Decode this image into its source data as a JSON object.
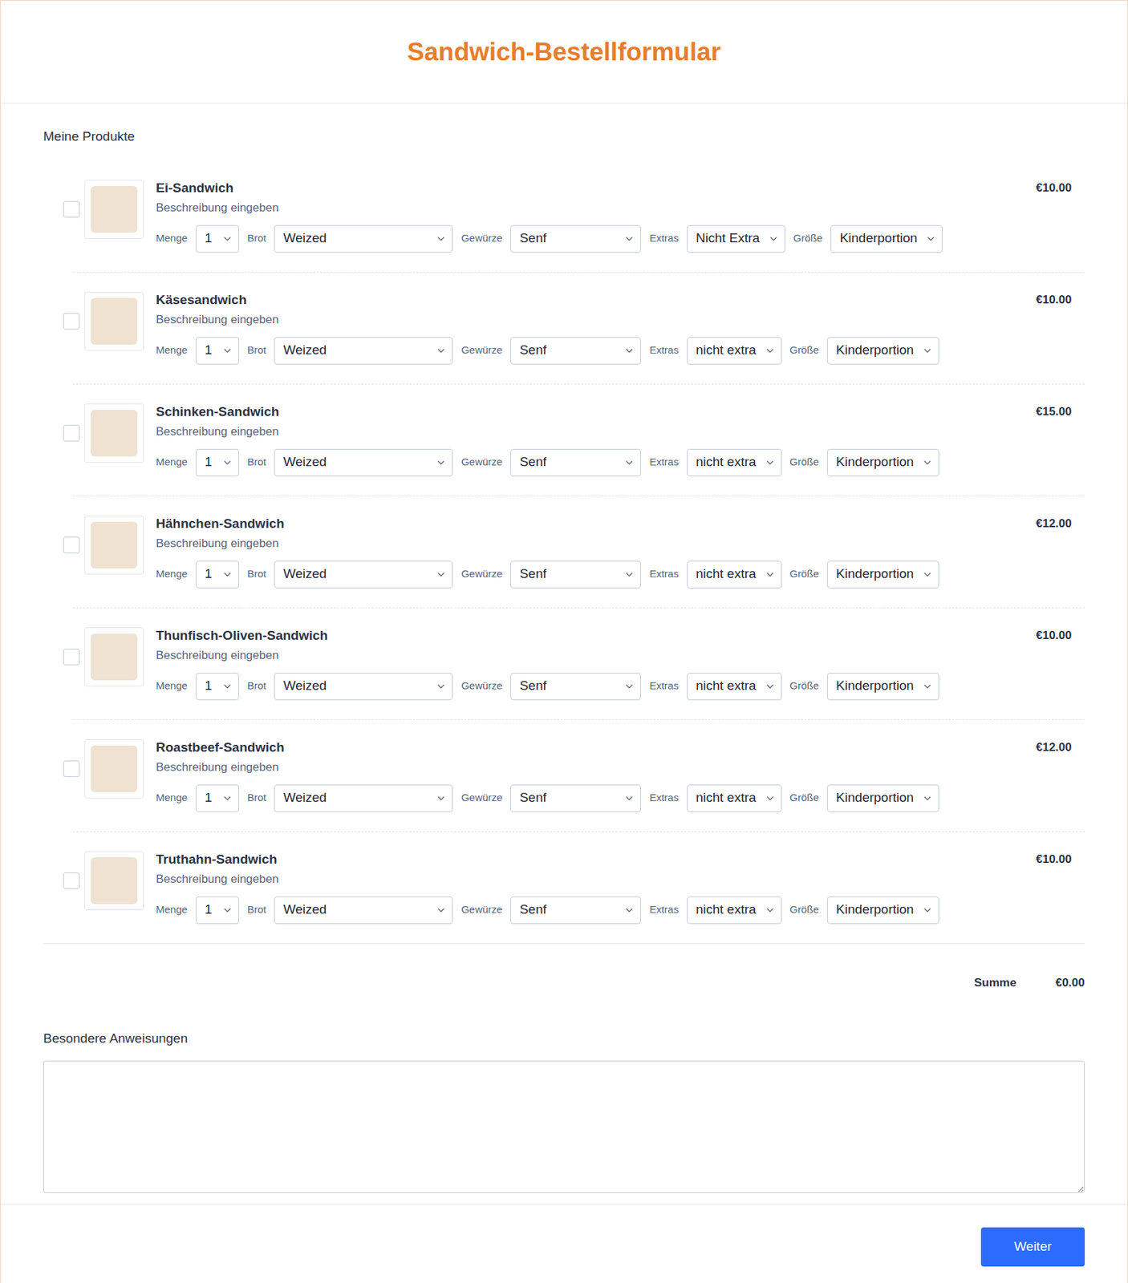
{
  "title": "Sandwich-Bestellformular",
  "products_section": {
    "title": "Meine Produkte"
  },
  "field_labels": {
    "quantity": "Menge",
    "bread": "Brot",
    "condiments": "Gewürze",
    "extras": "Extras",
    "size": "Größe"
  },
  "products": [
    {
      "name": "Ei-Sandwich",
      "description": "Beschreibung eingeben",
      "price": "€10.00",
      "checked": false,
      "quantity": "1",
      "bread": "Weized",
      "condiments": "Senf",
      "extras": "Nicht Extra",
      "size": "Kinderportion"
    },
    {
      "name": "Käsesandwich",
      "description": "Beschreibung eingeben",
      "price": "€10.00",
      "checked": false,
      "quantity": "1",
      "bread": "Weized",
      "condiments": "Senf",
      "extras": "nicht extra",
      "size": "Kinderportion"
    },
    {
      "name": "Schinken-Sandwich",
      "description": "Beschreibung eingeben",
      "price": "€15.00",
      "checked": false,
      "quantity": "1",
      "bread": "Weized",
      "condiments": "Senf",
      "extras": "nicht extra",
      "size": "Kinderportion"
    },
    {
      "name": "Hähnchen-Sandwich",
      "description": "Beschreibung eingeben",
      "price": "€12.00",
      "checked": false,
      "quantity": "1",
      "bread": "Weized",
      "condiments": "Senf",
      "extras": "nicht extra",
      "size": "Kinderportion"
    },
    {
      "name": "Thunfisch-Oliven-Sandwich",
      "description": "Beschreibung eingeben",
      "price": "€10.00",
      "checked": false,
      "quantity": "1",
      "bread": "Weized",
      "condiments": "Senf",
      "extras": "nicht extra",
      "size": "Kinderportion"
    },
    {
      "name": "Roastbeef-Sandwich",
      "description": "Beschreibung eingeben",
      "price": "€12.00",
      "checked": false,
      "quantity": "1",
      "bread": "Weized",
      "condiments": "Senf",
      "extras": "nicht extra",
      "size": "Kinderportion"
    },
    {
      "name": "Truthahn-Sandwich",
      "description": "Beschreibung eingeben",
      "price": "€10.00",
      "checked": false,
      "quantity": "1",
      "bread": "Weized",
      "condiments": "Senf",
      "extras": "nicht extra",
      "size": "Kinderportion"
    }
  ],
  "total": {
    "label": "Summe",
    "value": "€0.00"
  },
  "instructions": {
    "label": "Besondere Anweisungen",
    "value": ""
  },
  "buttons": [
    "Weiter"
  ]
}
